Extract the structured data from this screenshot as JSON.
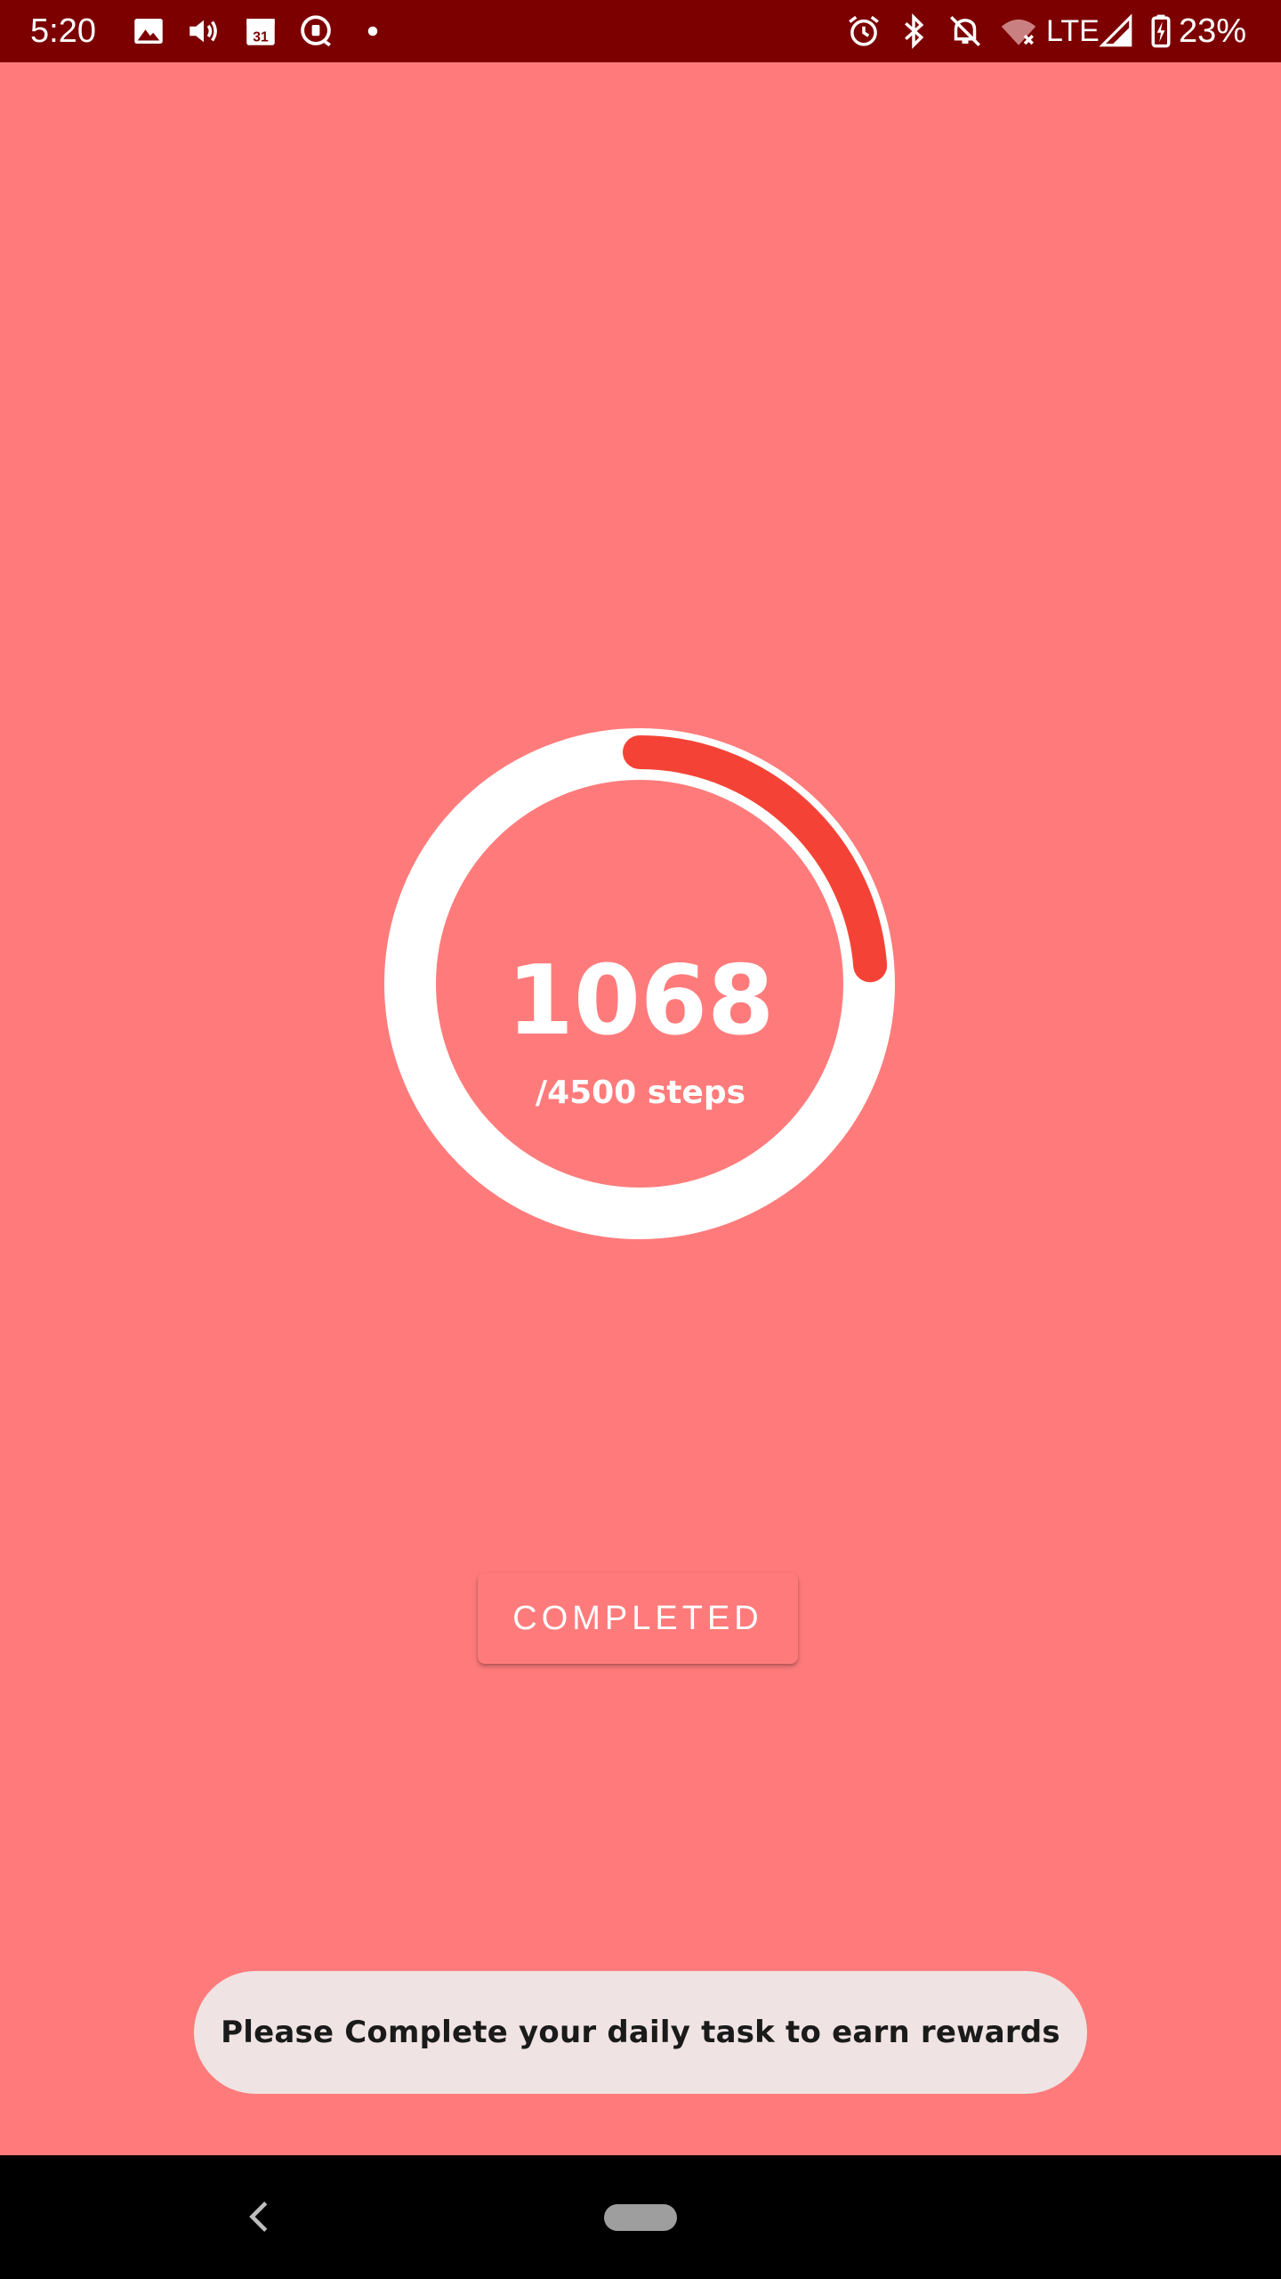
{
  "status_bar": {
    "time": "5:20",
    "network_label": "LTE",
    "battery_percent": "23%",
    "icons": [
      "image-icon",
      "volume-icon",
      "calendar-icon",
      "chat-icon",
      "notification-dot-icon",
      "alarm-icon",
      "bluetooth-icon",
      "mute-bell-icon",
      "wifi-off-icon",
      "signal-icon",
      "battery-charging-icon"
    ],
    "calendar_day": "31"
  },
  "steps": {
    "count": "1068",
    "goal_label": "/4500 steps",
    "progress_fraction": 0.2373
  },
  "completed_button": {
    "label": "COMPLETED"
  },
  "toast": {
    "message": "Please Complete your daily task to earn rewards"
  },
  "colors": {
    "background": "#FF7B7B",
    "status_bar": "#7C0000",
    "ring_track": "#FFFFFF",
    "ring_progress": "#F44336",
    "toast_background": "#EFE3E3"
  }
}
